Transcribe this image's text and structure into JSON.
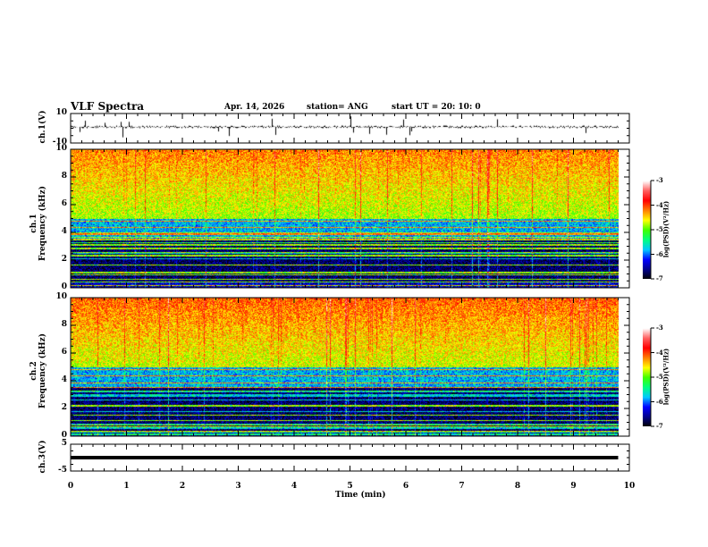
{
  "header": {
    "title": "VLF Spectra",
    "date": "Apr. 14, 2026",
    "station": "station= ANG",
    "start": "start  UT =   20: 10: 0"
  },
  "chart_data": [
    {
      "type": "line",
      "ylabel": "ch.1(V)",
      "ylim": [
        -10,
        10
      ],
      "yticks": [
        "10",
        "-10"
      ],
      "description_values": {
        "baseline": 0,
        "noise_amplitude": 1.5
      }
    },
    {
      "type": "heatmap",
      "ylabel": "ch.1\nFrequency (kHz)",
      "ylabel_lines": [
        "ch.1",
        "Frequency (kHz)"
      ],
      "ylim": [
        0,
        10
      ],
      "yticks": [
        "0",
        "2",
        "4",
        "6",
        "8",
        "10"
      ],
      "colorbar": {
        "label": "log(PSD)(V²/Hz)",
        "range": [
          -7,
          -3
        ],
        "ticks": [
          "-3",
          "-4",
          "-5",
          "-6",
          "-7"
        ]
      }
    },
    {
      "type": "heatmap",
      "ylabel_lines": [
        "ch.2",
        "Frequency (kHz)"
      ],
      "ylim": [
        0,
        10
      ],
      "yticks": [
        "0",
        "2",
        "4",
        "6",
        "8",
        "10"
      ],
      "colorbar": {
        "label": "log(PSD)(V²/Hz)",
        "range": [
          -7,
          -3
        ],
        "ticks": [
          "-3",
          "-4",
          "-5",
          "-6",
          "-7"
        ]
      }
    },
    {
      "type": "line",
      "ylabel": "ch.3(V)",
      "ylim": [
        -5,
        5
      ],
      "yticks": [
        "5",
        "-5"
      ],
      "values_constant": 0
    }
  ],
  "xaxis": {
    "label": "Time  (min)",
    "range": [
      0,
      10
    ],
    "ticks": [
      "0",
      "1",
      "2",
      "3",
      "4",
      "5",
      "6",
      "7",
      "8",
      "9",
      "10"
    ],
    "data_end": 9.8
  },
  "colors": {
    "colormap": [
      "#000000",
      "#00008c",
      "#0000ff",
      "#00c8ff",
      "#00ff80",
      "#40ff00",
      "#ffff00",
      "#ff8000",
      "#ff0000",
      "#ff6060",
      "#ffffff"
    ]
  }
}
